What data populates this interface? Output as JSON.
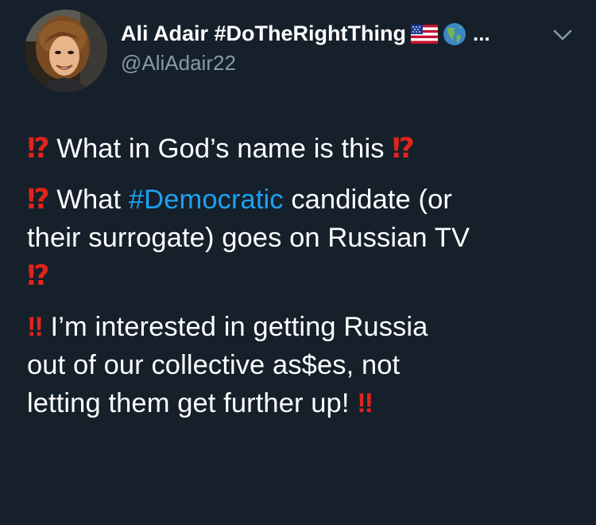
{
  "tweet": {
    "author": {
      "name": "Ali Adair #DoTheRightThing",
      "name_emojis": [
        "us-flag-emoji",
        "globe-americas-emoji"
      ],
      "name_truncation": "...",
      "handle": "@AliAdair22"
    },
    "paragraphs": [
      {
        "lines": [
          [
            {
              "type": "mark",
              "text": "⁉"
            },
            {
              "type": "text",
              "text": " What in God’s name is this "
            },
            {
              "type": "mark",
              "text": "⁉"
            }
          ]
        ]
      },
      {
        "lines": [
          [
            {
              "type": "mark",
              "text": "⁉"
            },
            {
              "type": "text",
              "text": " What "
            },
            {
              "type": "hashtag",
              "text": "#Democratic"
            },
            {
              "type": "text",
              "text": " candidate (or"
            }
          ],
          [
            {
              "type": "text",
              "text": "their surrogate) goes on Russian TV"
            }
          ],
          [
            {
              "type": "mark",
              "text": "⁉"
            }
          ]
        ]
      },
      {
        "lines": [
          [
            {
              "type": "mark",
              "text": "‼"
            },
            {
              "type": "text",
              "text": " I’m interested in getting Russia"
            }
          ],
          [
            {
              "type": "text",
              "text": "out of our collective as$es, not"
            }
          ],
          [
            {
              "type": "text",
              "text": "letting them get further up! "
            },
            {
              "type": "mark",
              "text": "‼"
            }
          ]
        ]
      }
    ]
  },
  "colors": {
    "background": "#15202b",
    "text": "#ffffff",
    "secondary": "#8899a6",
    "hashtag": "#1da1f2",
    "punctuation_emoji": "#e0241b"
  },
  "icons": {
    "menu": "chevron-down-icon"
  }
}
